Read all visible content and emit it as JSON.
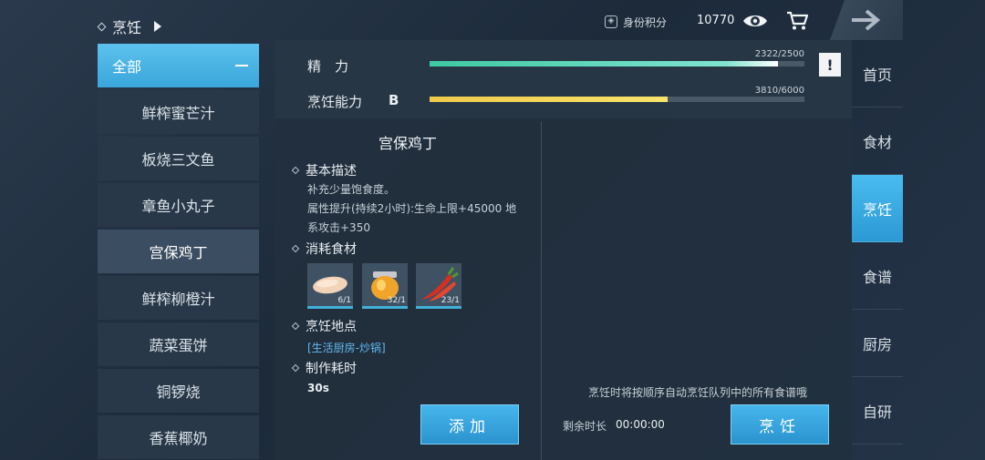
{
  "header": {
    "breadcrumb": "烹饪",
    "id_score_label": "身份积分",
    "id_score_value": "10770"
  },
  "left_list": {
    "all_label": "全部",
    "items": [
      "鲜榨蜜芒汁",
      "板烧三文鱼",
      "章鱼小丸子",
      "宫保鸡丁",
      "鲜榨柳橙汁",
      "蔬菜蛋饼",
      "铜锣烧",
      "香蕉椰奶"
    ],
    "selected": "宫保鸡丁"
  },
  "stats": {
    "energy_label": "精　力",
    "energy_value": "2322/2500",
    "energy_fraction": 0.9288,
    "cooking_label": "烹饪能力",
    "cooking_grade": "B",
    "cooking_value": "3810/6000",
    "cooking_fraction": 0.635,
    "colors": {
      "energy": "#3ec9a3",
      "cooking": "#f0c94a"
    }
  },
  "recipe": {
    "title": "宫保鸡丁",
    "desc_heading": "基本描述",
    "desc_line1": "补充少量饱食度。",
    "desc_line2": "属性提升(持续2小时):生命上限+45000 地",
    "desc_line3": "系攻击+350",
    "ingredients_heading": "消耗食材",
    "ingredients": [
      {
        "icon": "chicken-breast-icon",
        "count": "6/1"
      },
      {
        "icon": "sauce-jar-icon",
        "count": "32/1"
      },
      {
        "icon": "chili-pepper-icon",
        "count": "23/1"
      }
    ],
    "location_heading": "烹饪地点",
    "location": "[生活厨房-炒锅]",
    "time_heading": "制作耗时",
    "time": "30s",
    "add_button": "添加"
  },
  "queue": {
    "note": "烹饪时将按顺序自动烹饪队列中的所有食谱哦",
    "remain_label": "剩余时长",
    "remain_value": "00:00:00",
    "cook_button": "烹饪"
  },
  "right_nav": {
    "items": [
      "首页",
      "食材",
      "烹饪",
      "食谱",
      "厨房",
      "自研"
    ],
    "active": "烹饪"
  }
}
